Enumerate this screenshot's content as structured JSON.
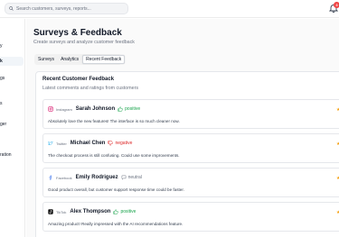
{
  "search": {
    "placeholder": "Search customers, surveys, reports..."
  },
  "notifications": {
    "count": "3"
  },
  "sidebar": {
    "items": [
      {
        "label": "y"
      },
      {
        "label": "k"
      },
      {
        "label": "gs"
      },
      {
        "label": "s"
      },
      {
        "label": "ger"
      },
      {
        "label": "ration"
      }
    ]
  },
  "page": {
    "title": "Surveys & Feedback",
    "subtitle": "Create surveys and analyze customer feedback"
  },
  "tabs": [
    {
      "label": "Surveys"
    },
    {
      "label": "Analytics"
    },
    {
      "label": "Recent Feedback"
    }
  ],
  "recent": {
    "title": "Recent Customer Feedback",
    "subtitle": "Latest comments and ratings from customers",
    "items": [
      {
        "source": "Instagram",
        "name": "Sarah Johnson",
        "sentiment": "positive",
        "comment": "Absolutely love the new features! The interface is so much cleaner now.",
        "stars": "★★"
      },
      {
        "source": "Twitter",
        "name": "Michael Chen",
        "sentiment": "negative",
        "comment": "The checkout process is still confusing. Could use some improvements.",
        "stars": "★★"
      },
      {
        "source": "Facebook",
        "name": "Emily Rodriguez",
        "sentiment": "neutral",
        "comment": "Good product overall, but customer support response time could be faster.",
        "stars": "★★"
      },
      {
        "source": "TikTok",
        "name": "Alex Thompson",
        "sentiment": "positive",
        "comment": "Amazing product! Really impressed with the AI recommendations feature.",
        "stars": "★★"
      }
    ]
  }
}
